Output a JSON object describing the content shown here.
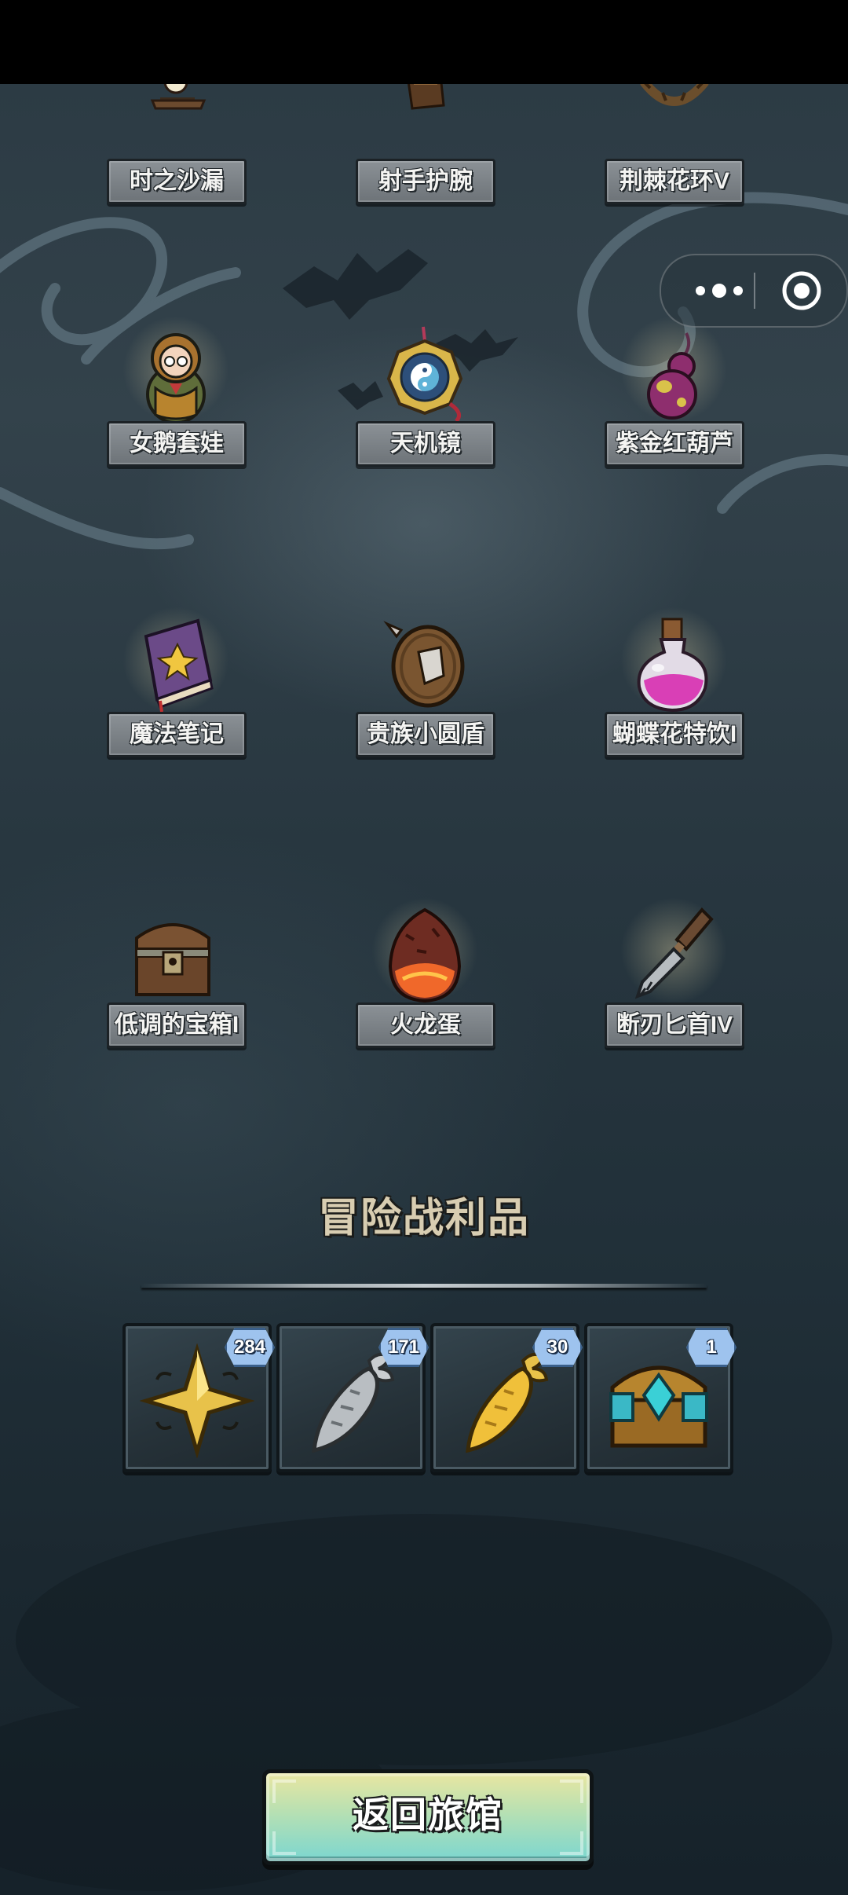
{
  "window": {
    "capsule_more_icon": "more-dots-icon",
    "capsule_close_icon": "target-circle-icon"
  },
  "collection": {
    "items": [
      {
        "name": "时之沙漏",
        "icon": "hourglass-icon"
      },
      {
        "name": "射手护腕",
        "icon": "bracer-icon"
      },
      {
        "name": "荆棘花环V",
        "icon": "thorn-wreath-icon"
      },
      {
        "name": "女鹅套娃",
        "icon": "nesting-doll-icon"
      },
      {
        "name": "天机镜",
        "icon": "bagua-mirror-icon"
      },
      {
        "name": "紫金红葫芦",
        "icon": "gourd-icon"
      },
      {
        "name": "魔法笔记",
        "icon": "magic-book-icon"
      },
      {
        "name": "贵族小圆盾",
        "icon": "round-shield-icon"
      },
      {
        "name": "蝴蝶花特饮I",
        "icon": "potion-bottle-icon"
      },
      {
        "name": "低调的宝箱I",
        "icon": "treasure-chest-icon"
      },
      {
        "name": "火龙蛋",
        "icon": "dragon-egg-icon"
      },
      {
        "name": "断刃匕首IV",
        "icon": "broken-dagger-icon"
      }
    ]
  },
  "loot": {
    "title": "冒险战利品",
    "items": [
      {
        "icon": "gold-star-icon",
        "count": "284"
      },
      {
        "icon": "silver-carrot-icon",
        "count": "171"
      },
      {
        "icon": "gold-carrot-icon",
        "count": "30"
      },
      {
        "icon": "jeweled-chest-icon",
        "count": "1"
      }
    ]
  },
  "actions": {
    "return_label": "返回旅馆"
  },
  "colors": {
    "label_bg": "#7c8287",
    "button_top": "#e9e6a1",
    "button_bottom": "#7bd6d0",
    "badge": "#9ec3ee",
    "title_text": "#d8cdb1"
  }
}
